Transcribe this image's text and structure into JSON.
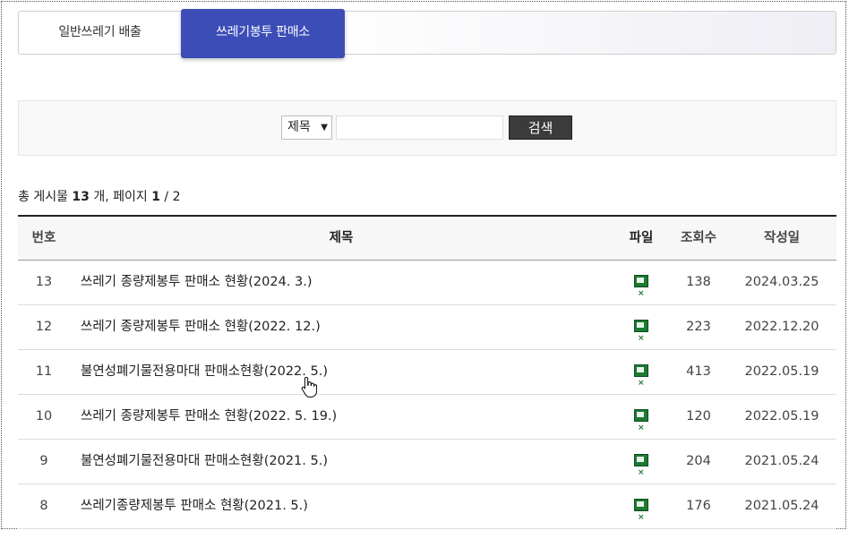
{
  "tabs": [
    {
      "label": "일반쓰레기 배출",
      "active": false
    },
    {
      "label": "쓰레기봉투 판매소",
      "active": true
    }
  ],
  "search": {
    "field_select_value": "제목",
    "input_value": "",
    "button_label": "검색"
  },
  "summary": {
    "prefix": "총 게시물 ",
    "count": "13",
    "count_suffix": " 개,  페이지 ",
    "page_current": "1",
    "page_total": " / 2"
  },
  "table": {
    "headers": {
      "num": "번호",
      "title": "제목",
      "file": "파일",
      "views": "조회수",
      "date": "작성일"
    },
    "rows": [
      {
        "num": "13",
        "title": "쓰레기 종량제봉투 판매소 현황(2024. 3.)",
        "file_icon": "excel-file-icon",
        "views": "138",
        "date": "2024.03.25"
      },
      {
        "num": "12",
        "title": "쓰레기 종량제봉투 판매소 현황(2022. 12.)",
        "file_icon": "excel-file-icon",
        "views": "223",
        "date": "2022.12.20"
      },
      {
        "num": "11",
        "title": "불연성폐기물전용마대 판매소현황(2022. 5.)",
        "file_icon": "excel-file-icon",
        "views": "413",
        "date": "2022.05.19"
      },
      {
        "num": "10",
        "title": "쓰레기 종량제봉투 판매소 현황(2022. 5. 19.)",
        "file_icon": "excel-file-icon",
        "views": "120",
        "date": "2022.05.19"
      },
      {
        "num": "9",
        "title": "불연성폐기물전용마대 판매소현황(2021. 5.)",
        "file_icon": "excel-file-icon",
        "views": "204",
        "date": "2021.05.24"
      },
      {
        "num": "8",
        "title": "쓰레기종량제봉투 판매소 현황(2021. 5.)",
        "file_icon": "excel-file-icon",
        "views": "176",
        "date": "2021.05.24"
      }
    ]
  },
  "colors": {
    "active_tab": "#3d4db7",
    "search_button": "#3b3b3b",
    "excel_icon": "#1d7a34"
  }
}
